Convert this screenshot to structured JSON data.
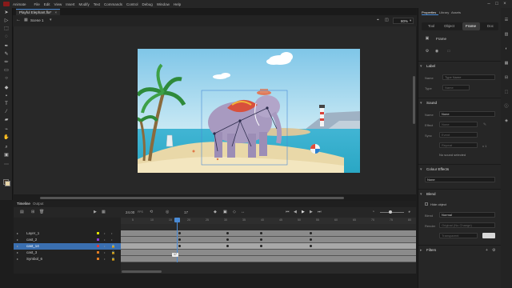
{
  "app": {
    "name": "Animate"
  },
  "menu": [
    "File",
    "Edit",
    "View",
    "Insert",
    "Modify",
    "Text",
    "Commands",
    "Control",
    "Debug",
    "Window",
    "Help"
  ],
  "document": {
    "tab_label": "Playful Elephant.fla*",
    "scene": "Scene 1",
    "zoom": "80%"
  },
  "timeline": {
    "tabs": [
      "Timeline",
      "Output"
    ],
    "fps": "24.00",
    "fps_unit": "FPS",
    "current_frame": "17",
    "frame_tooltip": "17",
    "ruler": [
      "5",
      "10",
      "15",
      "20",
      "25",
      "30",
      "35",
      "40",
      "45",
      "50",
      "55",
      "60",
      "65",
      "70",
      "75",
      "80"
    ],
    "layers": [
      {
        "name": "Layer_1",
        "selected": false,
        "color": "#e0e000"
      },
      {
        "name": "cast_2",
        "selected": false,
        "color": "#8a3dd6"
      },
      {
        "name": "cast_14",
        "selected": true,
        "color": "#e03a3a"
      },
      {
        "name": "cast_3",
        "selected": false,
        "color": "#e07b22"
      },
      {
        "name": "Symbol_6",
        "selected": false,
        "color": "#e07b22"
      }
    ]
  },
  "properties": {
    "tabs": [
      "Properties",
      "Library",
      "Assets"
    ],
    "subtabs": [
      "Tool",
      "Object",
      "Frame",
      "Doc"
    ],
    "active_subtab": "Frame",
    "frame_label": "Frame",
    "label_section": {
      "title": "Label",
      "name_label": "Name",
      "name_placeholder": "Type Name",
      "type_label": "Type",
      "type_value": "Name"
    },
    "sound_section": {
      "title": "Sound",
      "name_label": "Name",
      "name_value": "None",
      "effect_label": "Effect",
      "effect_value": "None",
      "sync_label": "Sync",
      "sync_value": "Event",
      "repeat_value": "Repeat",
      "repeat_count": "x 1",
      "status": "No sound selected"
    },
    "color_effects": {
      "title": "Colour Effects",
      "value": "None"
    },
    "blend": {
      "title": "Blend",
      "hide_object": "Hide object",
      "blend_label": "Blend",
      "blend_value": "Normal",
      "render_label": "Render",
      "render_value": "Original (No Change)",
      "transparent_value": "Transparent"
    },
    "filters": {
      "title": "Filters"
    }
  },
  "colors": {
    "accent": "#4a8bd6",
    "selection": "#3a6fb0"
  }
}
